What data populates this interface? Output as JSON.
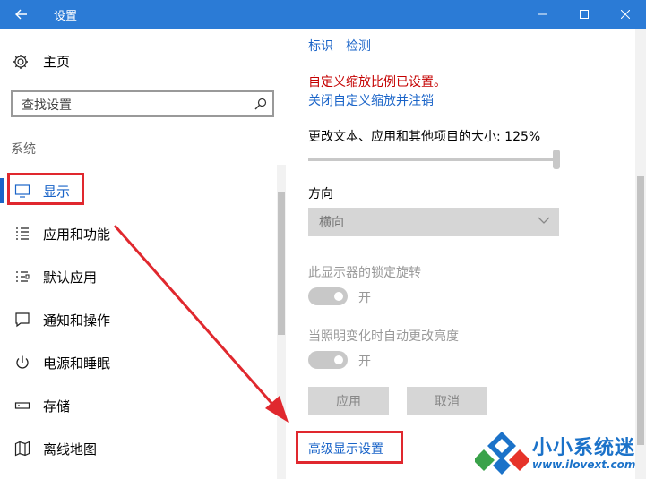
{
  "window": {
    "title": "设置",
    "accent": "#2b7bd6",
    "controls": [
      "minimize-icon",
      "maximize-icon",
      "close-icon"
    ]
  },
  "sidebar": {
    "home_label": "主页",
    "search_placeholder": "查找设置",
    "section_label": "系统",
    "items": [
      {
        "label": "显示",
        "icon": "monitor-icon",
        "active": true
      },
      {
        "label": "应用和功能",
        "icon": "list-icon"
      },
      {
        "label": "默认应用",
        "icon": "default-apps-icon"
      },
      {
        "label": "通知和操作",
        "icon": "notification-icon"
      },
      {
        "label": "电源和睡眠",
        "icon": "power-icon"
      },
      {
        "label": "存储",
        "icon": "storage-icon"
      },
      {
        "label": "离线地图",
        "icon": "map-icon"
      }
    ]
  },
  "main": {
    "link_identify": "标识",
    "link_detect": "检测",
    "custom_scale_notice": "自定义缩放比例已设置。",
    "custom_scale_link": "关闭自定义缩放并注销",
    "scale_label": "更改文本、应用和其他项目的大小: 125%",
    "orientation_label": "方向",
    "orientation_value": "横向",
    "rotation_lock_label": "此显示器的锁定旋转",
    "rotation_lock_state": "开",
    "auto_brightness_label": "当照明变化时自动更改亮度",
    "auto_brightness_state": "开",
    "apply_button": "应用",
    "cancel_button": "取消",
    "advanced_link": "高级显示设置"
  },
  "colors": {
    "link": "#1a64c8",
    "warning": "#c40000",
    "annotation": "#e0282e"
  },
  "watermark": {
    "brand": "小小系统迷",
    "url": "www.ilovext.com"
  }
}
